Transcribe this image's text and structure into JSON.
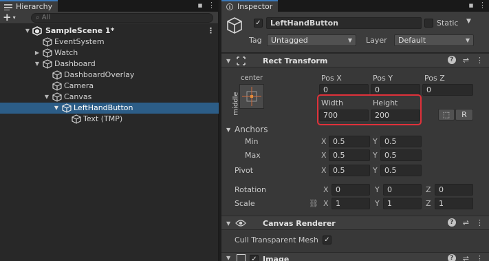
{
  "hierarchy": {
    "tab_label": "Hierarchy",
    "add_label": "+",
    "search_placeholder": "All",
    "rows": [
      {
        "label": "SampleScene 1*"
      },
      {
        "label": "EventSystem"
      },
      {
        "label": "Watch"
      },
      {
        "label": "Dashboard"
      },
      {
        "label": "DashboardOverlay"
      },
      {
        "label": "Camera"
      },
      {
        "label": "Canvas"
      },
      {
        "label": "LeftHandButton"
      },
      {
        "label": "Text (TMP)"
      }
    ],
    "selected_row": "LeftHandButton"
  },
  "inspector": {
    "tab_label": "Inspector",
    "object_name": "LeftHandButton",
    "active_checked": true,
    "static_label": "Static",
    "tag_label": "Tag",
    "tag_value": "Untagged",
    "layer_label": "Layer",
    "layer_value": "Default",
    "rect_transform": {
      "title": "Rect Transform",
      "anchor_h": "center",
      "anchor_v": "middle",
      "pos_x_label": "Pos X",
      "pos_x": "0",
      "pos_y_label": "Pos Y",
      "pos_y": "0",
      "pos_z_label": "Pos Z",
      "pos_z": "0",
      "width_label": "Width",
      "width": "700",
      "height_label": "Height",
      "height": "200",
      "r_button": "R",
      "anchors_label": "Anchors",
      "min_label": "Min",
      "min_x": "0.5",
      "min_y": "0.5",
      "max_label": "Max",
      "max_x": "0.5",
      "max_y": "0.5",
      "pivot_label": "Pivot",
      "pivot_x": "0.5",
      "pivot_y": "0.5",
      "rotation_label": "Rotation",
      "rot_x": "0",
      "rot_y": "0",
      "rot_z": "0",
      "scale_label": "Scale",
      "scale_x": "1",
      "scale_y": "1",
      "scale_z": "1",
      "x": "X",
      "y": "Y",
      "z": "Z"
    },
    "canvas_renderer": {
      "title": "Canvas Renderer",
      "cull_label": "Cull Transparent Mesh",
      "cull_checked": true
    },
    "image": {
      "title": "Image"
    }
  },
  "colors": {
    "selection": "#2c5d87",
    "highlight": "#e0313a",
    "accent": "#3a79bb"
  }
}
